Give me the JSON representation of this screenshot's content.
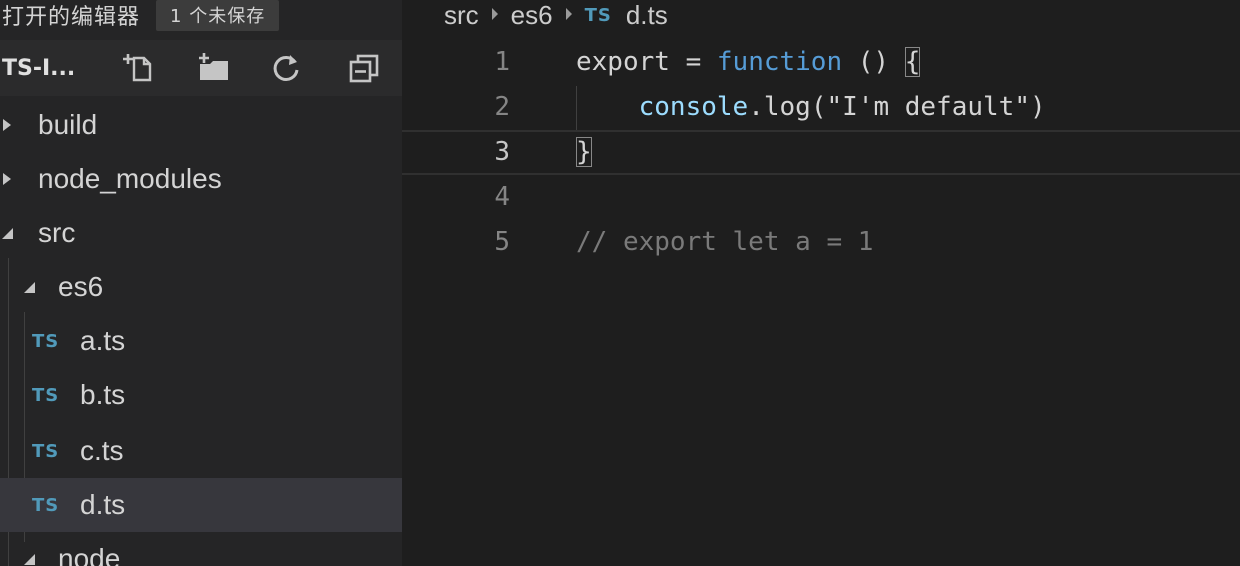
{
  "sidebar": {
    "open_editors_title": "打开的编辑器",
    "unsaved_badge": "1 个未保存",
    "project_name": "TS-I...",
    "toolbar_icons": [
      "new-file-icon",
      "new-folder-icon",
      "refresh-icon",
      "collapse-all-icon"
    ],
    "tree": [
      {
        "label": "build",
        "type": "folder",
        "expanded": false,
        "depth": 0
      },
      {
        "label": "node_modules",
        "type": "folder",
        "expanded": false,
        "depth": 0
      },
      {
        "label": "src",
        "type": "folder",
        "expanded": true,
        "depth": 0
      },
      {
        "label": "es6",
        "type": "folder",
        "expanded": true,
        "depth": 1
      },
      {
        "label": "a.ts",
        "type": "file",
        "icon": "TS",
        "depth": 2
      },
      {
        "label": "b.ts",
        "type": "file",
        "icon": "TS",
        "depth": 2
      },
      {
        "label": "c.ts",
        "type": "file",
        "icon": "TS",
        "depth": 2
      },
      {
        "label": "d.ts",
        "type": "file",
        "icon": "TS",
        "depth": 2,
        "selected": true
      },
      {
        "label": "node",
        "type": "folder",
        "expanded": true,
        "depth": 1
      }
    ]
  },
  "breadcrumbs": {
    "items": [
      "src",
      "es6",
      "d.ts"
    ],
    "file_icon": "TS"
  },
  "editor": {
    "current_line": 3,
    "line_numbers": [
      "1",
      "2",
      "3",
      "4",
      "5"
    ],
    "lines": [
      {
        "tokens": [
          {
            "t": "export",
            "c": "plain"
          },
          {
            "t": " = ",
            "c": "plain"
          },
          {
            "t": "function",
            "c": "kw"
          },
          {
            "t": " () ",
            "c": "plain"
          },
          {
            "t": "{",
            "c": "plain"
          }
        ]
      },
      {
        "tokens": [
          {
            "t": "    ",
            "c": "plain"
          },
          {
            "t": "console",
            "c": "var"
          },
          {
            "t": ".log(",
            "c": "plain"
          },
          {
            "t": "\"I'm default\"",
            "c": "plain"
          },
          {
            "t": ")",
            "c": "plain"
          }
        ]
      },
      {
        "tokens": [
          {
            "t": "}",
            "c": "plain"
          }
        ]
      },
      {
        "tokens": []
      },
      {
        "tokens": [
          {
            "t": "// export let a = 1",
            "c": "cmt"
          }
        ]
      }
    ]
  },
  "colors": {
    "ts_icon": "#519aba",
    "sidebar_bg": "#252526",
    "editor_bg": "#1e1e1e",
    "selection_bg": "#37373d"
  }
}
